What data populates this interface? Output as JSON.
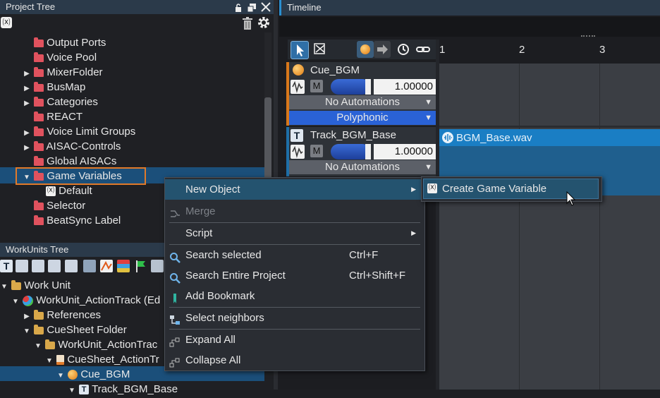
{
  "project_tree": {
    "title": "Project Tree",
    "items": [
      {
        "label": "Output Ports",
        "expandable": false
      },
      {
        "label": "Voice Pool",
        "expandable": false
      },
      {
        "label": "MixerFolder",
        "expandable": true
      },
      {
        "label": "BusMap",
        "expandable": true
      },
      {
        "label": "Categories",
        "expandable": true
      },
      {
        "label": "REACT",
        "expandable": false
      },
      {
        "label": "Voice Limit Groups",
        "expandable": true
      },
      {
        "label": "AISAC-Controls",
        "expandable": true
      },
      {
        "label": "Global AISACs",
        "expandable": false
      },
      {
        "label": "Game Variables",
        "expandable": true,
        "expanded": true,
        "selected": true
      },
      {
        "label": "Default",
        "child": true
      },
      {
        "label": "Selector",
        "expandable": false
      },
      {
        "label": "BeatSync Label",
        "expandable": false
      }
    ]
  },
  "workunits_tree": {
    "title": "WorkUnits Tree",
    "items": [
      {
        "label": "Work Unit"
      },
      {
        "label": "WorkUnit_ActionTrack (Ed"
      },
      {
        "label": "References"
      },
      {
        "label": "CueSheet Folder"
      },
      {
        "label": "WorkUnit_ActionTrac"
      },
      {
        "label": "CueSheet_ActionTr"
      },
      {
        "label": "Cue_BGM"
      },
      {
        "label": "Track_BGM_Base"
      }
    ]
  },
  "timeline": {
    "title": "Timeline",
    "ruler": [
      "1",
      "2",
      "3"
    ],
    "cue": {
      "name": "Cue_BGM",
      "mute": "M",
      "volume": "1.00000",
      "automation": "No Automations",
      "mode": "Polyphonic"
    },
    "track": {
      "name": "Track_BGM_Base",
      "mute": "M",
      "volume": "1.00000",
      "automation": "No Automations"
    },
    "clip": {
      "name": "BGM_Base.wav"
    }
  },
  "context_menu": {
    "items": [
      {
        "label": "New Object",
        "submenu": true,
        "highlighted": true
      },
      {
        "label": "Merge",
        "disabled": true
      },
      {
        "label": "Script",
        "submenu": true
      },
      {
        "label": "Search selected",
        "shortcut": "Ctrl+F"
      },
      {
        "label": "Search Entire Project",
        "shortcut": "Ctrl+Shift+F"
      },
      {
        "label": "Add Bookmark"
      },
      {
        "label": "Select neighbors"
      },
      {
        "label": "Expand All"
      },
      {
        "label": "Collapse All"
      }
    ]
  },
  "submenu": {
    "items": [
      {
        "label": "Create Game Variable"
      }
    ]
  },
  "colors": {
    "accent": "#1e6fa8",
    "selection_outline": "#e07a2a",
    "menu_bg": "#2a2d33",
    "highlight": "#24536f"
  }
}
